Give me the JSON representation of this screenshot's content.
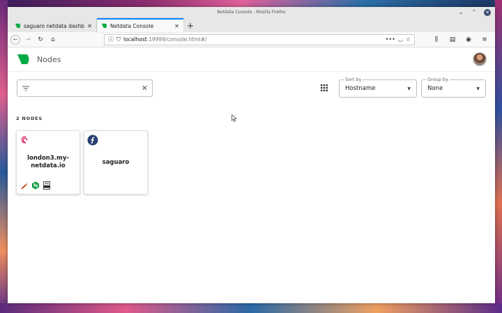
{
  "browser": {
    "window_title": "Netdata Console - Mozilla Firefox",
    "tabs": [
      {
        "label": "saguaro netdata dashboar",
        "active": false
      },
      {
        "label": "Netdata Console",
        "active": true
      }
    ],
    "url_host": "localhost",
    "url_path": ":19999/console.html#/",
    "url_more": "•••"
  },
  "app": {
    "title": "Nodes",
    "brand_color": "#00ab44",
    "filter": {
      "value": ""
    },
    "sort": {
      "legend": "Sort by",
      "value": "Hostname"
    },
    "group": {
      "legend": "Group by",
      "value": "None"
    },
    "count_label": "2 NODES",
    "nodes": [
      {
        "name": "london3.my-netdata.io",
        "os_icon": "debian-icon",
        "services": [
          "apache-icon",
          "nginx-icon",
          "logs-icon"
        ]
      },
      {
        "name": "saguaro",
        "os_icon": "fedora-icon",
        "services": []
      }
    ]
  }
}
